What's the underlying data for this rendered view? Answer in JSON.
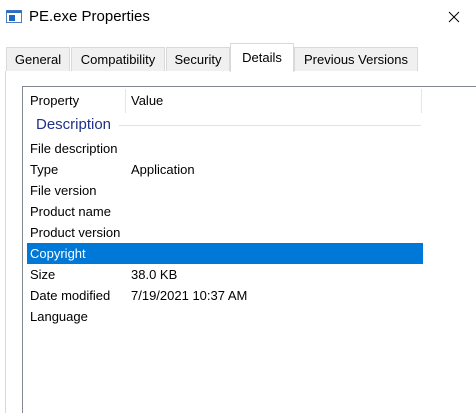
{
  "window": {
    "title": "PE.exe Properties",
    "icon": "application-window-icon",
    "close_icon": "close-icon"
  },
  "tabs": [
    {
      "label": "General",
      "active": false
    },
    {
      "label": "Compatibility",
      "active": false
    },
    {
      "label": "Security",
      "active": false
    },
    {
      "label": "Details",
      "active": true
    },
    {
      "label": "Previous Versions",
      "active": false
    }
  ],
  "details": {
    "columns": {
      "property": "Property",
      "value": "Value"
    },
    "group": "Description",
    "rows": [
      {
        "property": "File description",
        "value": "",
        "selected": false
      },
      {
        "property": "Type",
        "value": "Application",
        "selected": false
      },
      {
        "property": "File version",
        "value": "",
        "selected": false
      },
      {
        "property": "Product name",
        "value": "",
        "selected": false
      },
      {
        "property": "Product version",
        "value": "",
        "selected": false
      },
      {
        "property": "Copyright",
        "value": "",
        "selected": true
      },
      {
        "property": "Size",
        "value": "38.0 KB",
        "selected": false
      },
      {
        "property": "Date modified",
        "value": "7/19/2021 10:37 AM",
        "selected": false
      },
      {
        "property": "Language",
        "value": "",
        "selected": false
      }
    ]
  },
  "colors": {
    "selection": "#0078d7",
    "group_label": "#1e3287"
  }
}
